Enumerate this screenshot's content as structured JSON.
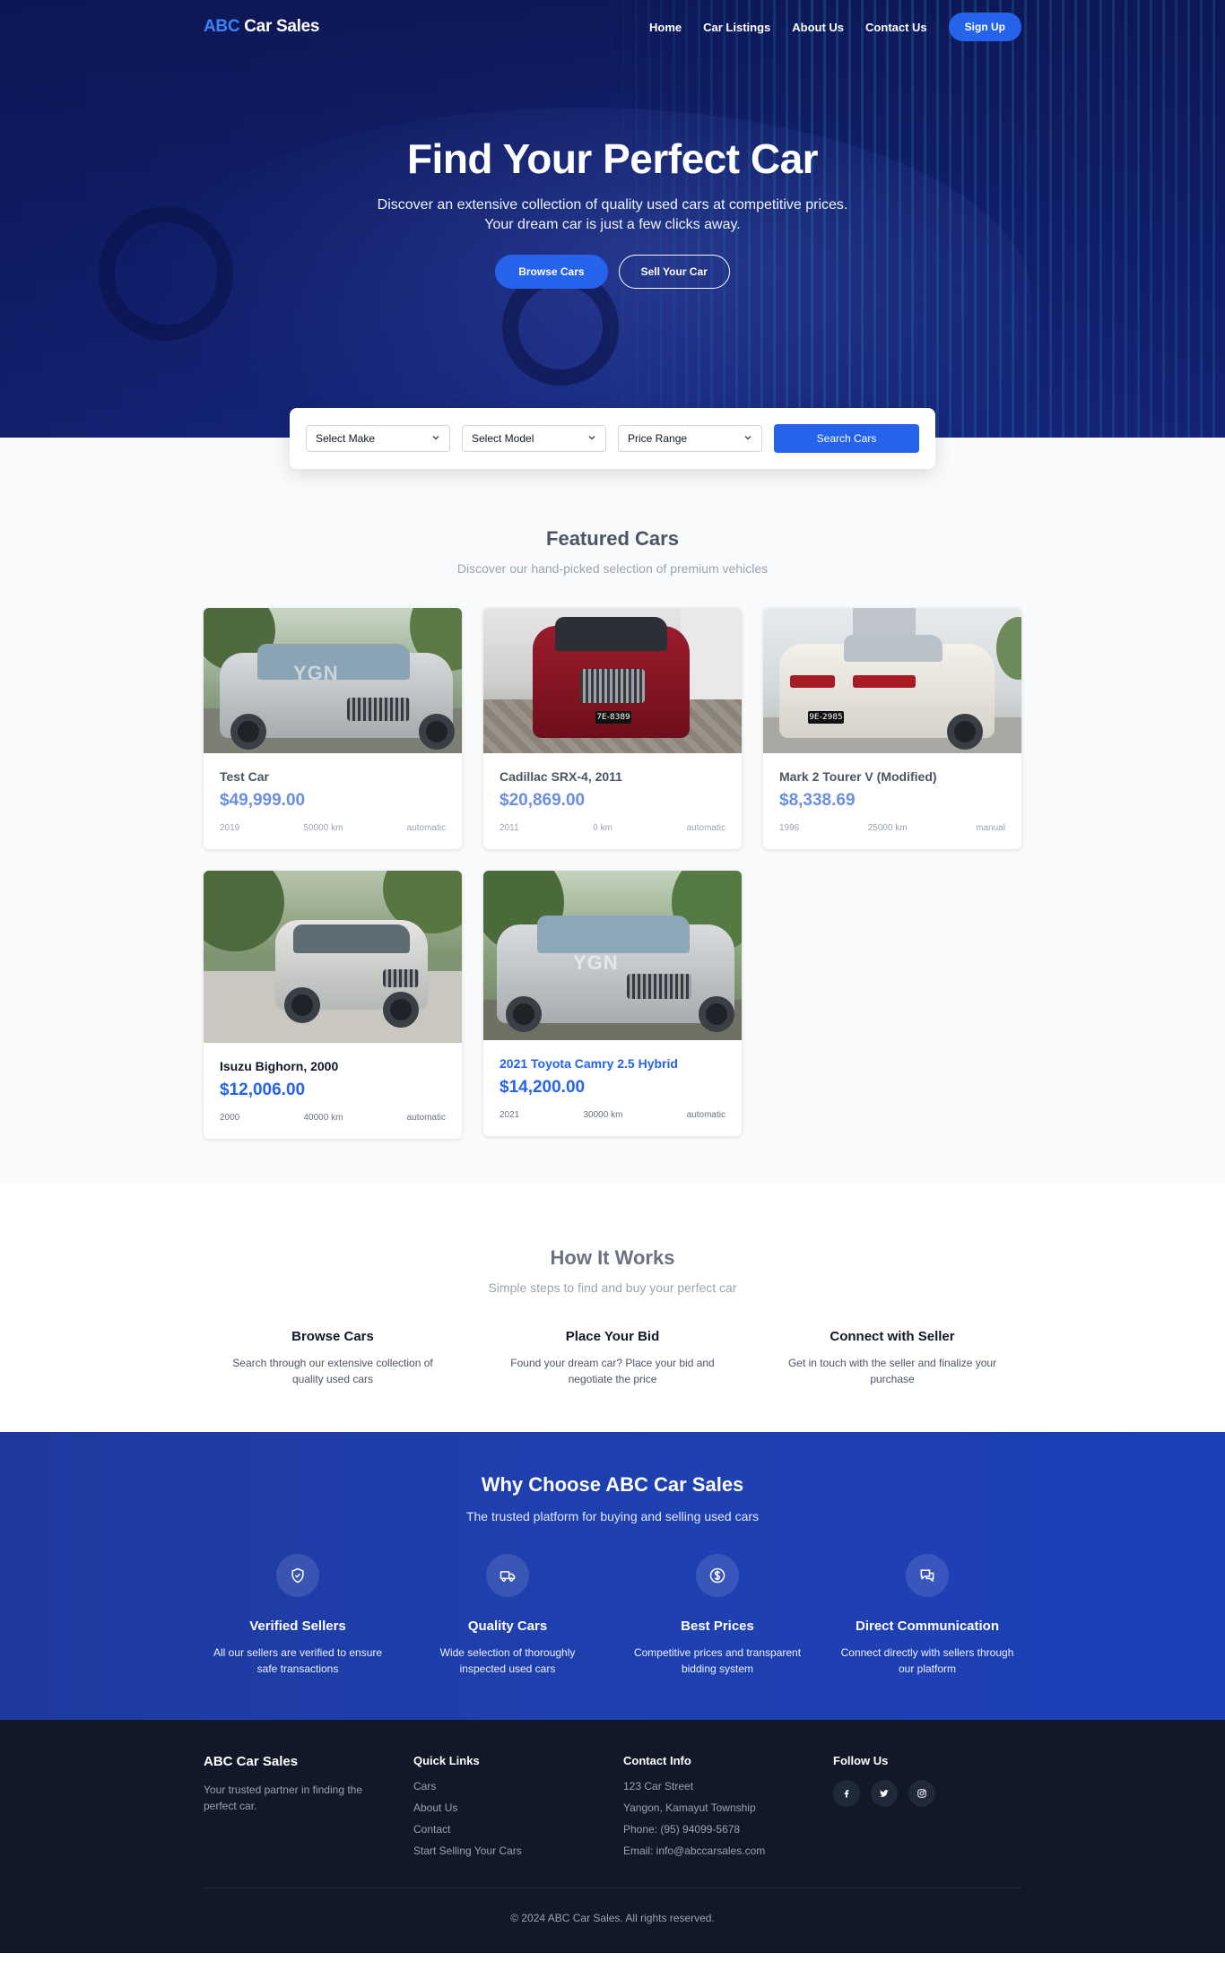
{
  "nav": {
    "logo_accent": "ABC",
    "logo_rest": "Car Sales",
    "links": [
      "Home",
      "Car Listings",
      "About Us",
      "Contact Us"
    ],
    "signup": "Sign Up"
  },
  "hero": {
    "title": "Find Your Perfect Car",
    "subtitle_line1": "Discover an extensive collection of quality used cars at competitive prices.",
    "subtitle_line2": "Your dream car is just a few clicks away.",
    "browse_button": "Browse Cars",
    "sell_button": "Sell Your Car"
  },
  "search": {
    "make": "Select Make",
    "model": "Select Model",
    "price": "Price Range",
    "button": "Search Cars"
  },
  "featured": {
    "title": "Featured Cars",
    "subtitle": "Discover our hand-picked selection of premium vehicles",
    "cars": [
      {
        "title": "Test Car",
        "price": "$49,999.00",
        "year": "2019",
        "mileage": "50000 km",
        "transmission": "automatic"
      },
      {
        "title": "Cadillac SRX-4, 2011",
        "price": "$20,869.00",
        "year": "2011",
        "mileage": "0 km",
        "transmission": "automatic",
        "plate": "7E-8389"
      },
      {
        "title": "Mark 2 Tourer V (Modified)",
        "price": "$8,338.69",
        "year": "1996",
        "mileage": "25000 km",
        "transmission": "manual",
        "plate": "9E-2985"
      },
      {
        "title": "Isuzu Bighorn, 2000",
        "price": "$12,006.00",
        "year": "2000",
        "mileage": "40000 km",
        "transmission": "automatic"
      },
      {
        "title": "2021 Toyota Camry 2.5 Hybrid",
        "price": "$14,200.00",
        "year": "2021",
        "mileage": "30000 km",
        "transmission": "automatic"
      }
    ],
    "watermark": "YGN"
  },
  "how": {
    "title": "How It Works",
    "subtitle": "Simple steps to find and buy your perfect car",
    "steps": [
      {
        "title": "Browse Cars",
        "desc": "Search through our extensive collection of quality used cars"
      },
      {
        "title": "Place Your Bid",
        "desc": "Found your dream car? Place your bid and negotiate the price"
      },
      {
        "title": "Connect with Seller",
        "desc": "Get in touch with the seller and finalize your purchase"
      }
    ]
  },
  "why": {
    "title": "Why Choose ABC Car Sales",
    "subtitle": "The trusted platform for buying and selling used cars",
    "features": [
      {
        "title": "Verified Sellers",
        "desc": "All our sellers are verified to ensure safe transactions",
        "icon": "shield-check-icon"
      },
      {
        "title": "Quality Cars",
        "desc": "Wide selection of thoroughly inspected used cars",
        "icon": "truck-icon"
      },
      {
        "title": "Best Prices",
        "desc": "Competitive prices and transparent bidding system",
        "icon": "dollar-circle-icon"
      },
      {
        "title": "Direct Communication",
        "desc": "Connect directly with sellers through our platform",
        "icon": "chat-bubbles-icon"
      }
    ]
  },
  "footer": {
    "brand": "ABC Car Sales",
    "tagline": "Your trusted partner in finding the perfect car.",
    "quick_links_title": "Quick Links",
    "quick_links": [
      "Cars",
      "About Us",
      "Contact",
      "Start Selling Your Cars"
    ],
    "contact_title": "Contact Info",
    "contact": [
      "123 Car Street",
      "Yangon, Kamayut Township",
      "Phone: (95) 94099-5678",
      "Email: info@abccarsales.com"
    ],
    "follow_title": "Follow Us",
    "copyright": "© 2024 ABC Car Sales. All rights reserved."
  },
  "colors": {
    "primary": "#2563eb",
    "hero_bg": "#14237a",
    "why_bg": "#1e40af",
    "footer_bg": "#111827"
  }
}
